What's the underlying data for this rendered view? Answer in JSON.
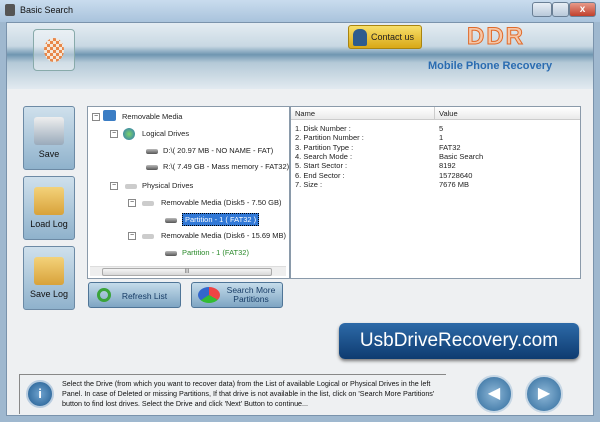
{
  "window": {
    "title": "Basic Search",
    "close": "x"
  },
  "header": {
    "contact_label": "Contact us",
    "brand": "DDR",
    "product": "Mobile Phone Recovery"
  },
  "side_buttons": [
    {
      "label": "Save"
    },
    {
      "label": "Load Log"
    },
    {
      "label": "Save Log"
    }
  ],
  "tree": {
    "root": "Removable Media",
    "logical": "Logical Drives",
    "logical_items": [
      "D:\\( 20.97 MB - NO NAME - FAT)",
      "R:\\( 7.49 GB - Mass memory - FAT32)"
    ],
    "physical": "Physical Drives",
    "disk5": "Removable Media (Disk5 - 7.50 GB)",
    "disk5_part": "Partition - 1 ( FAT32 )",
    "disk6": "Removable Media (Disk6 - 15.69 MB)",
    "disk6_part": "Partition - 1 (FAT32)",
    "scroll_grip": "III"
  },
  "details": {
    "headers": [
      "Name",
      "Value"
    ],
    "rows": [
      {
        "name": "1. Disk Number :",
        "value": "5"
      },
      {
        "name": "2. Partition Number :",
        "value": "1"
      },
      {
        "name": "3. Partition Type :",
        "value": "FAT32"
      },
      {
        "name": "4. Search Mode :",
        "value": "Basic Search"
      },
      {
        "name": "5. Start Sector :",
        "value": "8192"
      },
      {
        "name": "6. End Sector :",
        "value": "15728640"
      },
      {
        "name": "7. Size :",
        "value": "7676 MB"
      }
    ]
  },
  "actions": {
    "refresh": "Refresh List",
    "search_more": "Search More Partitions"
  },
  "banner": "UsbDriveRecovery.com",
  "info": {
    "text": "Select the Drive (from which you want to recover data) from the List of available Logical or Physical Drives in the left Panel. In case of Deleted or missing Partitions, If that drive is not available in the list, click on 'Search More Partitions' button to find lost drives. Select the Drive and click 'Next' Button to continue...",
    "icon_glyph": "i"
  },
  "nav": {
    "back": "◀",
    "next": "▶"
  }
}
